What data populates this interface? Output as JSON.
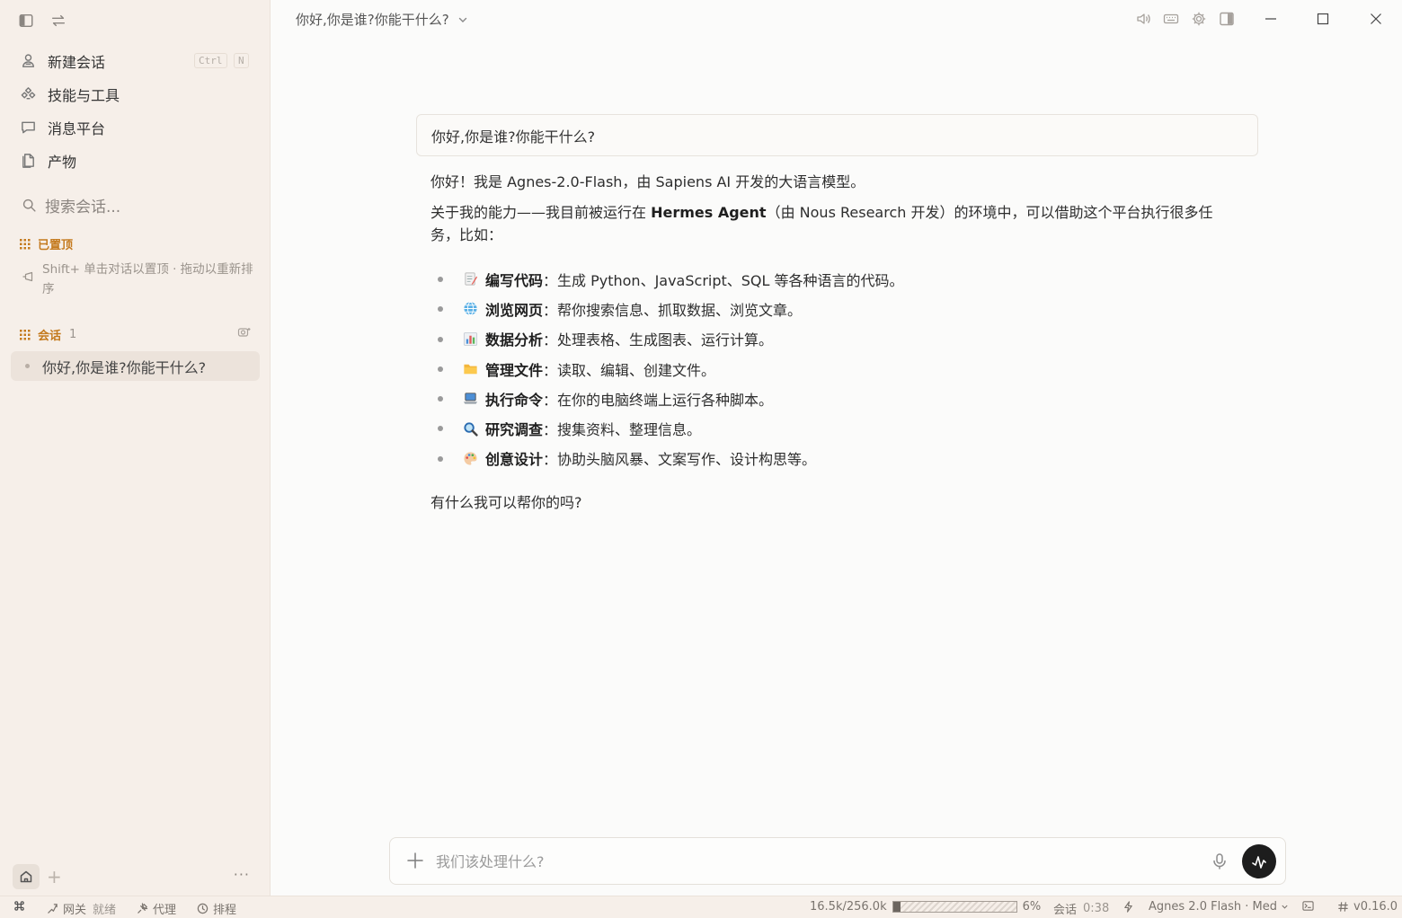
{
  "window": {
    "conversation_title": "你好,你是谁?你能干什么?"
  },
  "sidebar": {
    "nav": [
      {
        "label": "新建会话",
        "icon": "new-chat-icon",
        "shortcut": [
          "Ctrl",
          "N"
        ]
      },
      {
        "label": "技能与工具",
        "icon": "skills-tools-icon"
      },
      {
        "label": "消息平台",
        "icon": "message-bubble-icon"
      },
      {
        "label": "产物",
        "icon": "document-copy-icon"
      }
    ],
    "search_placeholder": "搜索会话...",
    "pinned": {
      "title": "已置顶",
      "hint": "Shift+ 单击对话以置顶 · 拖动以重新排序"
    },
    "sessions": {
      "title": "会话",
      "count": "1",
      "items": [
        {
          "label": "你好,你是谁?你能干什么?"
        }
      ]
    },
    "bottom": {
      "add_label": "+",
      "more_label": "···"
    }
  },
  "chat": {
    "user_message": "你好,你是谁?你能干什么?",
    "reply": {
      "intro": "你好！我是 Agnes-2.0-Flash，由 Sapiens AI 开发的大语言模型。",
      "env_prefix": "关于我的能力——我目前被运行在 ",
      "env_bold": "Hermes Agent",
      "env_suffix": "（由 Nous Research 开发）的环境中，可以借助这个平台执行很多任务，比如：",
      "capabilities": [
        {
          "emoji": "memo-icon",
          "title": "编写代码",
          "desc": "：生成 Python、JavaScript、SQL 等各种语言的代码。"
        },
        {
          "emoji": "globe-icon",
          "title": "浏览网页",
          "desc": "：帮你搜索信息、抓取数据、浏览文章。"
        },
        {
          "emoji": "bar-chart-icon",
          "title": "数据分析",
          "desc": "：处理表格、生成图表、运行计算。"
        },
        {
          "emoji": "folder-icon",
          "title": "管理文件",
          "desc": "：读取、编辑、创建文件。"
        },
        {
          "emoji": "laptop-icon",
          "title": "执行命令",
          "desc": "：在你的电脑终端上运行各种脚本。"
        },
        {
          "emoji": "magnifier-icon",
          "title": "研究调查",
          "desc": "：搜集资料、整理信息。"
        },
        {
          "emoji": "palette-icon",
          "title": "创意设计",
          "desc": "：协助头脑风暴、文案写作、设计构思等。"
        }
      ],
      "closing": "有什么我可以帮你的吗?"
    }
  },
  "composer": {
    "placeholder": "我们该处理什么?"
  },
  "status_bar": {
    "gateway_label": "网关",
    "gateway_state": "就绪",
    "proxy_label": "代理",
    "schedule_label": "排程",
    "context_usage": "16.5k/256.0k",
    "context_percent": "6%",
    "context_fraction": 0.06,
    "session_label": "会话",
    "session_time": "0:38",
    "model": "Agnes 2.0 Flash · Med",
    "version": "v0.16.0"
  },
  "colors": {
    "accent_orange": "#c47a1e",
    "sidebar_bg": "#f6efe9",
    "send_button": "#1d1d1d"
  }
}
